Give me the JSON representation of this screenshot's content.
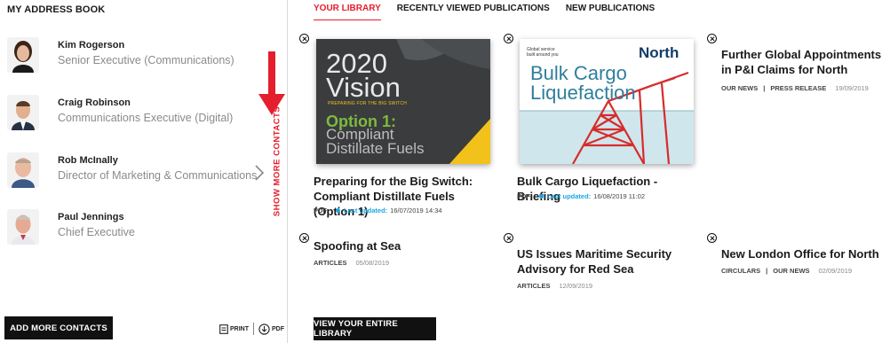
{
  "address_book": {
    "title": "MY ADDRESS BOOK",
    "contacts": [
      {
        "name": "Kim Rogerson",
        "role": "Senior Executive (Communications)"
      },
      {
        "name": "Craig Robinson",
        "role": "Communications Executive (Digital)"
      },
      {
        "name": "Rob McInally",
        "role": "Director of Marketing & Communications"
      },
      {
        "name": "Paul Jennings",
        "role": "Chief Executive"
      }
    ],
    "show_more": "SHOW MORE CONTACTS",
    "add_more": "ADD MORE CONTACTS",
    "print": "PRINT",
    "pdf": "PDF"
  },
  "tabs": [
    "YOUR LIBRARY",
    "RECENTLY VIEWED PUBLICATIONS",
    "NEW PUBLICATIONS"
  ],
  "active_tab": "YOUR LIBRARY",
  "publications": [
    {
      "title": "Preparing for the Big Switch: Compliant Distillate Fuels (Option 1)",
      "format": "PDF",
      "last_updated_label": "Last updated:",
      "last_updated": "16/07/2019 14:34",
      "cover": {
        "year": "2020",
        "word": "Vision",
        "subtitle": "PREPARING FOR THE BIG SWITCH",
        "option": "Option 1:",
        "line1": "Compliant",
        "line2": "Distillate Fuels"
      }
    },
    {
      "title": "Bulk Cargo Liquefaction - Briefing",
      "format": "PDF",
      "last_updated_label": "Last updated:",
      "last_updated": "16/08/2019 11:02",
      "cover": {
        "tagline1": "Global service",
        "tagline2": "built around you",
        "brand": "North",
        "line1": "Bulk Cargo",
        "line2": "Liquefaction"
      }
    },
    {
      "title": "Further Global Appointments in P&I Claims for North",
      "tags": [
        "OUR NEWS",
        "PRESS RELEASE"
      ],
      "date": "19/09/2019"
    },
    {
      "title": "Spoofing at Sea",
      "tags": [
        "ARTICLES"
      ],
      "date": "05/08/2019"
    },
    {
      "title": "US Issues Maritime Security Advisory for Red Sea",
      "tags": [
        "ARTICLES"
      ],
      "date": "12/09/2019"
    },
    {
      "title": "New London Office for North",
      "tags": [
        "CIRCULARS",
        "OUR NEWS"
      ],
      "date": "02/09/2019"
    }
  ],
  "view_library": "VIEW YOUR ENTIRE LIBRARY",
  "colors": {
    "accent": "#e41e2d",
    "info": "#1aa7e0",
    "dark_button": "#111111"
  }
}
